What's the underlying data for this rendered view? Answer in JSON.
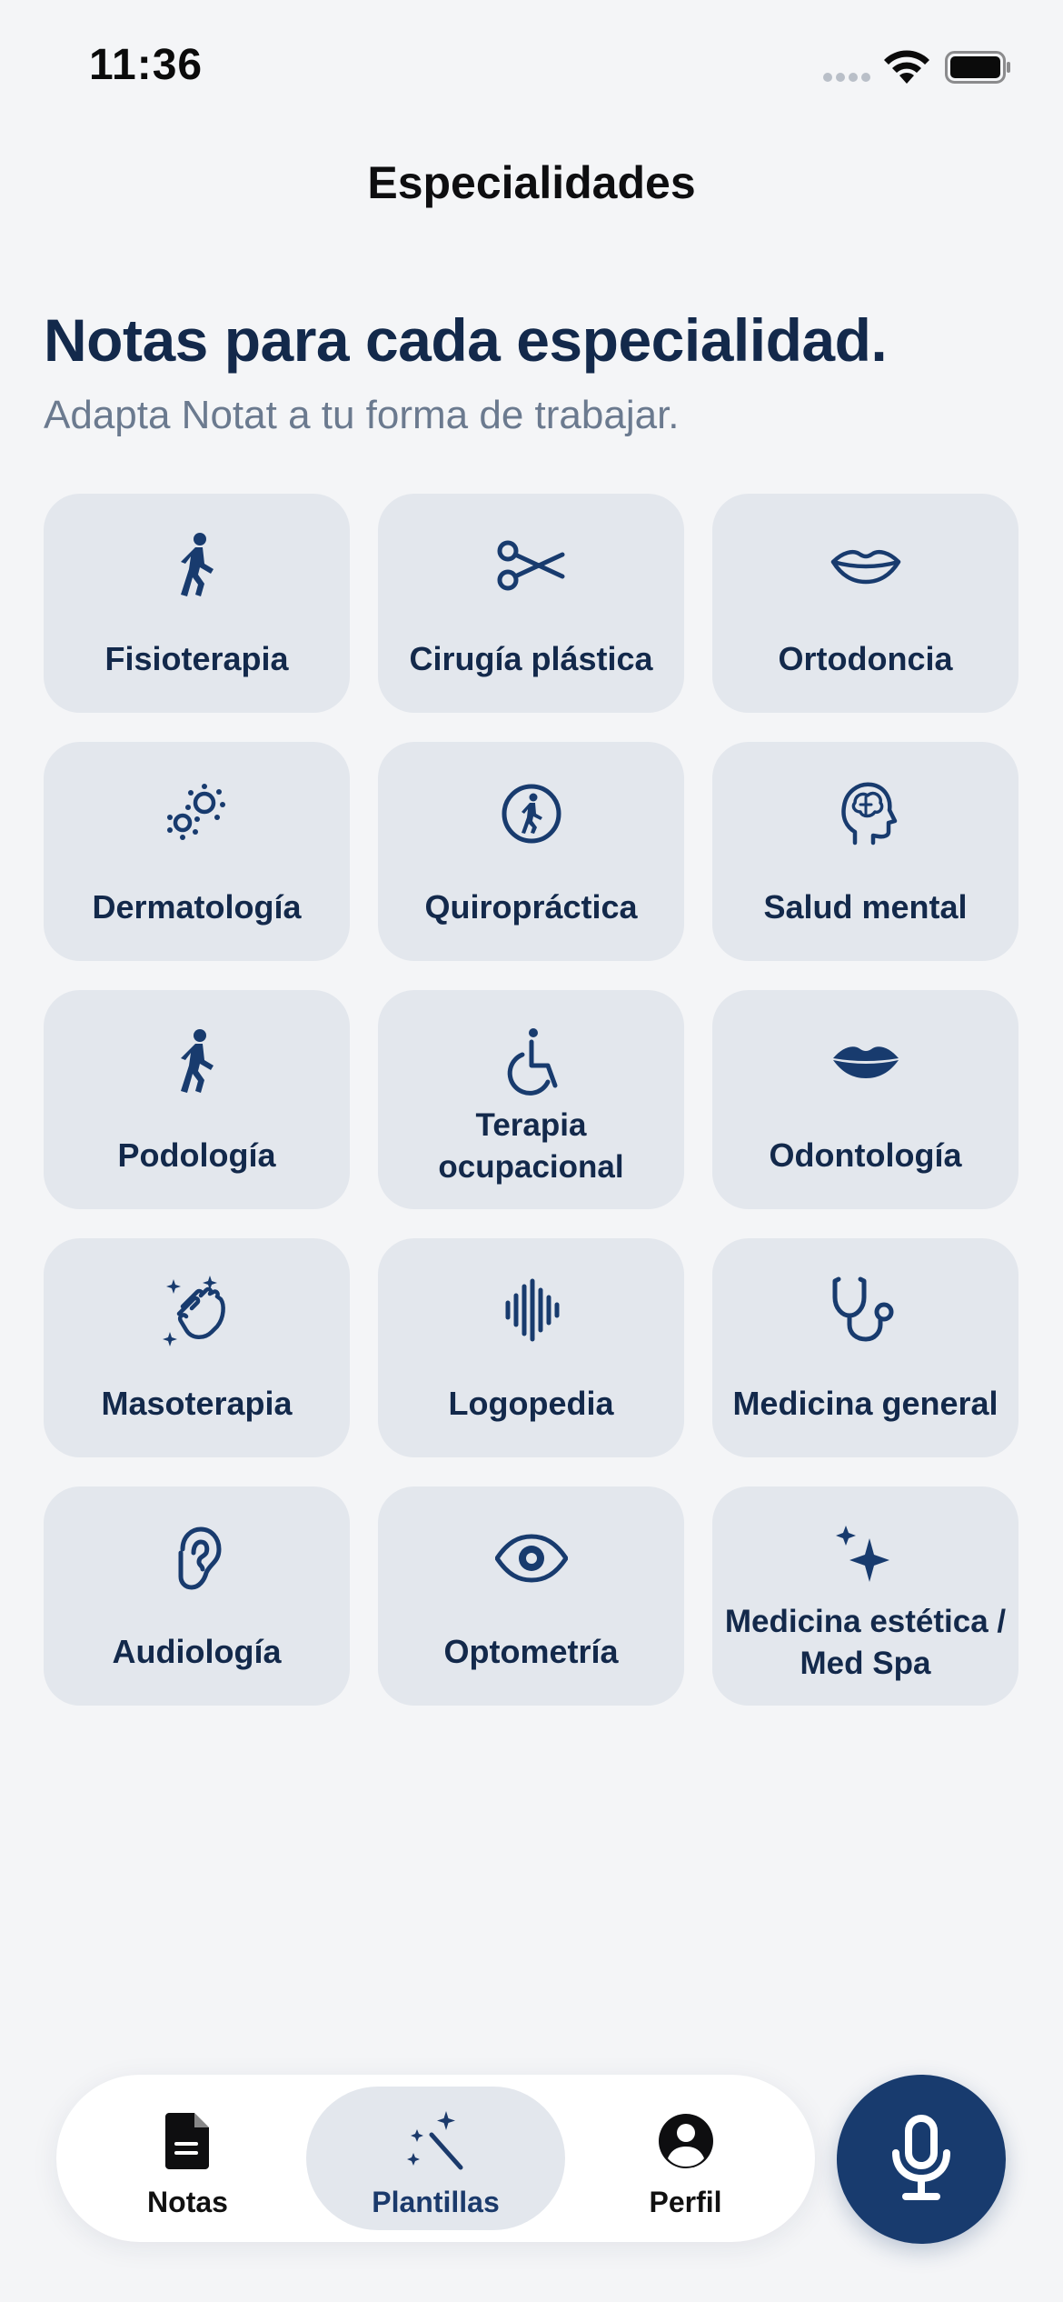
{
  "status_bar": {
    "time": "11:36"
  },
  "nav": {
    "title": "Especialidades"
  },
  "hero": {
    "title": "Notas para cada especialidad.",
    "subtitle": "Adapta Notat a tu forma de trabajar."
  },
  "specialties": [
    {
      "label": "Fisioterapia",
      "icon": "walking-figure-icon"
    },
    {
      "label": "Cirugía plástica",
      "icon": "scissors-icon"
    },
    {
      "label": "Ortodoncia",
      "icon": "lips-outline-icon"
    },
    {
      "label": "Dermatología",
      "icon": "allergens-icon"
    },
    {
      "label": "Quiropráctica",
      "icon": "walking-circle-icon"
    },
    {
      "label": "Salud mental",
      "icon": "brain-head-icon"
    },
    {
      "label": "Podología",
      "icon": "walking-figure-icon"
    },
    {
      "label": "Terapia ocupacional",
      "icon": "wheelchair-icon"
    },
    {
      "label": "Odontología",
      "icon": "lips-filled-icon"
    },
    {
      "label": "Masoterapia",
      "icon": "hands-clap-sparkles-icon"
    },
    {
      "label": "Logopedia",
      "icon": "waveform-icon"
    },
    {
      "label": "Medicina general",
      "icon": "stethoscope-icon"
    },
    {
      "label": "Audiología",
      "icon": "ear-icon"
    },
    {
      "label": "Optometría",
      "icon": "eye-icon"
    },
    {
      "label": "Medicina estética / Med Spa",
      "icon": "sparkles-icon"
    }
  ],
  "tabbar": {
    "notas": "Notas",
    "plantillas": "Plantillas",
    "perfil": "Perfil",
    "active": "plantillas"
  },
  "colors": {
    "accent": "#183b6e",
    "text": "#13294b",
    "card_bg": "#e3e7ed",
    "page_bg": "#f4f5f7",
    "muted": "#6b7a8f"
  }
}
